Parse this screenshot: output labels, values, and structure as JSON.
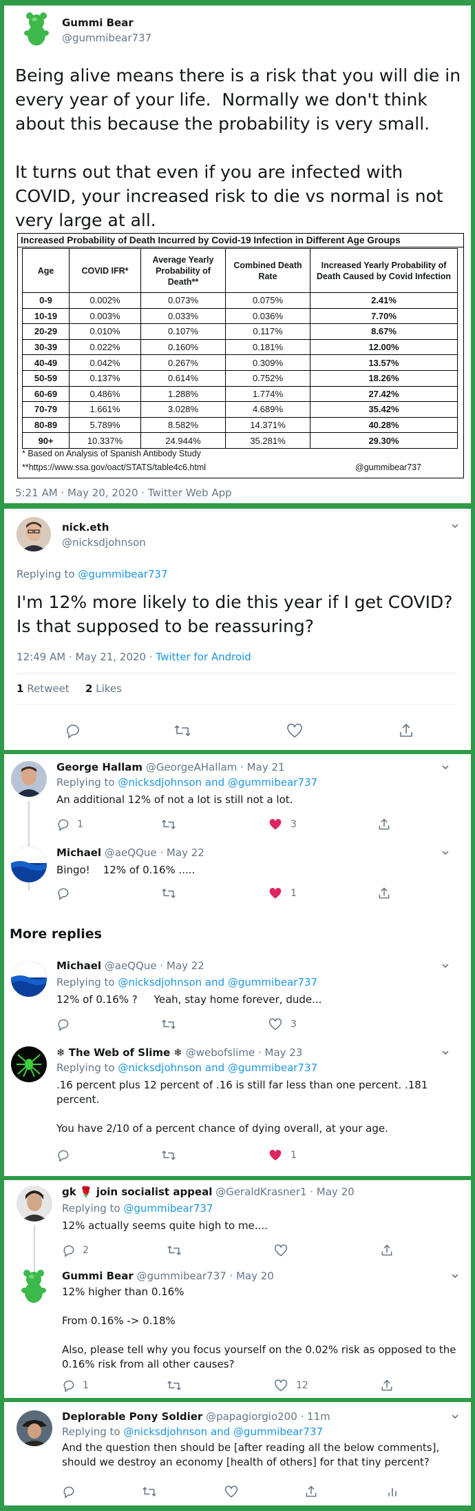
{
  "main_tweet": {
    "name": "Gummi Bear",
    "handle": "@gummibear737",
    "text": "Being alive means there is a risk that you will die in every year of your life.  Normally we don't think about this because the probability is very small.\n\nIt turns out that even if you are infected with COVID, your increased risk to die vs normal is not very large at all.",
    "timestamp": "5:21 AM · May 20, 2020 · Twitter Web App"
  },
  "table": {
    "title": "Increased Probability of Death Incurred by Covid-19 Infection in Different Age Groups",
    "headers": [
      "Age",
      "COVID IFR*",
      "Average Yearly Probability of Death**",
      "Combined Death Rate",
      "Increased Yearly Probability of Death Caused by Covid Infection"
    ],
    "rows": [
      [
        "0-9",
        "0.002%",
        "0.073%",
        "0.075%",
        "2.41%"
      ],
      [
        "10-19",
        "0.003%",
        "0.033%",
        "0.036%",
        "7.70%"
      ],
      [
        "20-29",
        "0.010%",
        "0.107%",
        "0.117%",
        "8.67%"
      ],
      [
        "30-39",
        "0.022%",
        "0.160%",
        "0.181%",
        "12.00%"
      ],
      [
        "40-49",
        "0.042%",
        "0.267%",
        "0.309%",
        "13.57%"
      ],
      [
        "50-59",
        "0.137%",
        "0.614%",
        "0.752%",
        "18.26%"
      ],
      [
        "60-69",
        "0.486%",
        "1.288%",
        "1.774%",
        "27.42%"
      ],
      [
        "70-79",
        "1.661%",
        "3.028%",
        "4.689%",
        "35.42%"
      ],
      [
        "80-89",
        "5.789%",
        "8.582%",
        "14.371%",
        "40.28%"
      ],
      [
        "90+",
        "10.337%",
        "24.944%",
        "35.281%",
        "29.30%"
      ]
    ],
    "note1": "* Based on Analysis of Spanish Antibody Study",
    "note2": "**https://www.ssa.gov/oact/STATS/table4c6.html",
    "credit": "@gummibear737"
  },
  "nick_tweet": {
    "name": "nick.eth",
    "handle": "@nicksdjohnson",
    "replying_prefix": "Replying to ",
    "replying_to": "@gummibear737",
    "text": "I'm 12% more likely to die this year if I get COVID? Is that supposed to be reassuring?",
    "timestamp_a": "12:49 AM · May 21, 2020 · ",
    "timestamp_b": "Twitter for Android",
    "retweets_count": "1",
    "retweets_label": "Retweet",
    "likes_count": "2",
    "likes_label": "Likes"
  },
  "replies": [
    {
      "name": "George Hallam",
      "meta": "@GeorgeAHallam · May 21",
      "replying_prefix": "Replying to ",
      "replying_to": "@nicksdjohnson and @gummibear737",
      "text": "An additional 12% of not a lot is still not a lot.",
      "reply_count": "1",
      "like_count": "3"
    },
    {
      "name": "Michael",
      "meta": "@aeQQue · May 22",
      "text": "Bingo!    12% of 0.16% .....",
      "like_count": "1"
    }
  ],
  "more_replies_label": "More replies",
  "more": [
    {
      "name": "Michael",
      "meta": "@aeQQue · May 22",
      "replying_prefix": "Replying to ",
      "replying_to": "@nicksdjohnson and @gummibear737",
      "text": "12% of 0.16% ?     Yeah, stay home forever, dude...",
      "like_count": "3"
    },
    {
      "name": "❄ The Web of Slime ❄",
      "meta": "@webofslime · May 23",
      "replying_prefix": "Replying to ",
      "replying_to": "@nicksdjohnson and @gummibear737",
      "text": ".16 percent plus 12 percent of .16 is still far less than one percent. .181 percent.\n\nYou have 2/10 of a percent chance of dying overall, at your age.",
      "like_count": "1"
    },
    {
      "name": "gk 🌹 join socialist appeal",
      "meta": "@GeraldKrasner1 · May 20",
      "replying_prefix": "Replying to ",
      "replying_to": "@gummibear737",
      "text": "12% actually seems quite high to me....",
      "reply_count": "2"
    },
    {
      "name": "Gummi Bear",
      "meta": "@gummibear737 · May 20",
      "text": "12% higher than 0.16%\n\nFrom 0.16% -> 0.18%\n\nAlso, please tell why you focus yourself on the 0.02% risk as opposed to the 0.16% risk from all other causes?",
      "reply_count": "1",
      "like_count": "12"
    },
    {
      "name": "Deplorable Pony Soldier",
      "meta": "@papagiorgio200 · 11m",
      "replying_prefix": "Replying to ",
      "replying_to": "@nicksdjohnson and @gummibear737",
      "text": "And the question then should be [after reading all the below comments], should we destroy an economy [health of others] for that tiny percent?"
    }
  ],
  "icons": {
    "reply": "reply-icon",
    "retweet": "retweet-icon",
    "like": "heart-icon",
    "share": "share-icon",
    "analytics": "analytics-icon",
    "chevron": "chevron-down-icon"
  },
  "colors": {
    "border_green": "#2f9a4a",
    "link_blue": "#1b95e0",
    "like_red": "#e0245e",
    "grey": "#657786"
  }
}
